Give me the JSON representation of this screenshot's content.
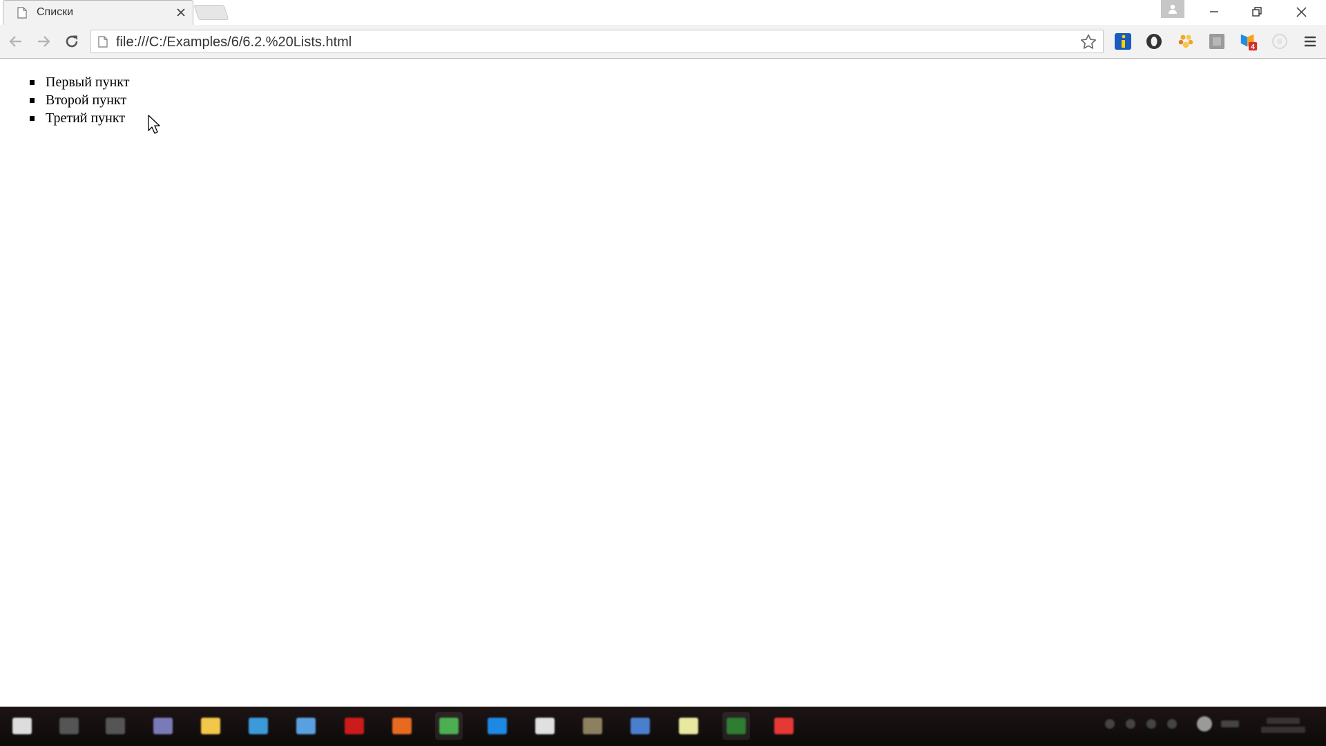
{
  "browser": {
    "tab": {
      "title": "Списки",
      "icon": "page-icon"
    },
    "address": {
      "url": "file:///C:/Examples/6/6.2.%20Lists.html"
    },
    "extensions": [
      {
        "name": "info-extension-icon",
        "color": "#1a5bbf"
      },
      {
        "name": "circle-extension-icon",
        "color": "#333333"
      },
      {
        "name": "paw-extension-icon",
        "color": "#f2a623"
      },
      {
        "name": "grey-box-extension-icon",
        "color": "#9a9a9a"
      },
      {
        "name": "shield-extension-icon",
        "color": "#f7a21b",
        "badge": "4"
      },
      {
        "name": "faded-circle-extension-icon",
        "color": "#d8d8d8"
      }
    ]
  },
  "page": {
    "list_items": [
      "Первый пункт",
      "Второй пункт",
      "Третий пункт"
    ]
  },
  "taskbar": {
    "icons": [
      {
        "name": "start-icon",
        "color": "#dddddd"
      },
      {
        "name": "search-icon",
        "color": "#555555"
      },
      {
        "name": "task-view-icon",
        "color": "#555555"
      },
      {
        "name": "app-icon",
        "color": "#7a7ab8"
      },
      {
        "name": "file-explorer-icon",
        "color": "#f1c84a"
      },
      {
        "name": "edge-browser-icon",
        "color": "#3b9ad9"
      },
      {
        "name": "ie-browser-icon",
        "color": "#5aa0e0"
      },
      {
        "name": "opera-icon",
        "color": "#cc1b1b"
      },
      {
        "name": "firefox-icon",
        "color": "#e86a20"
      },
      {
        "name": "chrome-icon",
        "color": "#4caf50"
      },
      {
        "name": "blue-app-icon",
        "color": "#1e88e5"
      },
      {
        "name": "white-app-icon",
        "color": "#e0e0e0"
      },
      {
        "name": "grey-app-icon",
        "color": "#8d8060"
      },
      {
        "name": "word-app-icon",
        "color": "#4a7fd0"
      },
      {
        "name": "notes-app-icon",
        "color": "#e8e8a0"
      },
      {
        "name": "green-app-icon",
        "color": "#2e7d32"
      },
      {
        "name": "red-app-icon",
        "color": "#e53935"
      }
    ]
  }
}
